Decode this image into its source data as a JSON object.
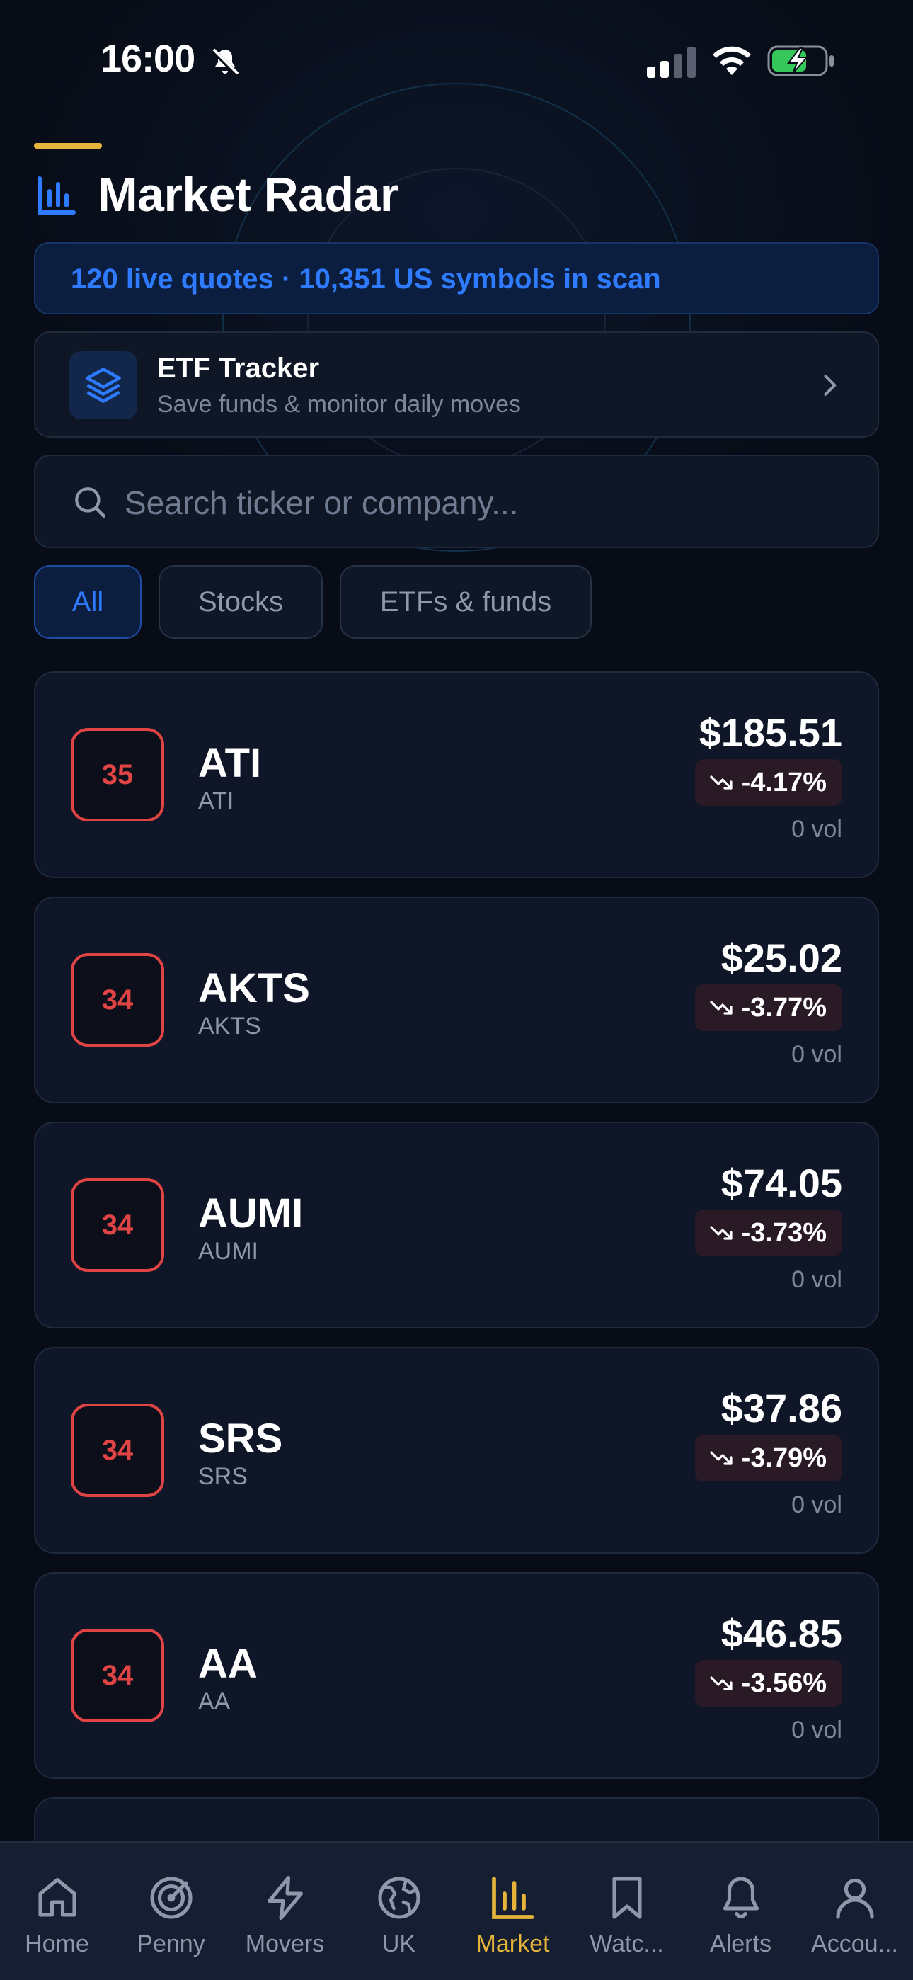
{
  "status_bar": {
    "time": "16:00"
  },
  "header": {
    "title": "Market Radar"
  },
  "live_banner": {
    "text": "120 live quotes · 10,351 US symbols in scan"
  },
  "etf_card": {
    "title": "ETF Tracker",
    "subtitle": "Save funds & monitor daily moves"
  },
  "search": {
    "placeholder": "Search ticker or company..."
  },
  "filters": {
    "all": "All",
    "stocks": "Stocks",
    "etfs": "ETFs & funds",
    "selected": "All"
  },
  "stocks": [
    {
      "score": "35",
      "ticker": "ATI",
      "name": "ATI",
      "price": "$185.51",
      "change": "-4.17%",
      "volume": "0 vol"
    },
    {
      "score": "34",
      "ticker": "AKTS",
      "name": "AKTS",
      "price": "$25.02",
      "change": "-3.77%",
      "volume": "0 vol"
    },
    {
      "score": "34",
      "ticker": "AUMI",
      "name": "AUMI",
      "price": "$74.05",
      "change": "-3.73%",
      "volume": "0 vol"
    },
    {
      "score": "34",
      "ticker": "SRS",
      "name": "SRS",
      "price": "$37.86",
      "change": "-3.79%",
      "volume": "0 vol"
    },
    {
      "score": "34",
      "ticker": "AA",
      "name": "AA",
      "price": "$46.85",
      "change": "-3.56%",
      "volume": "0 vol"
    }
  ],
  "tabs": [
    {
      "label": "Home",
      "icon": "home-icon"
    },
    {
      "label": "Penny",
      "icon": "radar-icon"
    },
    {
      "label": "Movers",
      "icon": "bolt-icon"
    },
    {
      "label": "UK",
      "icon": "globe-icon"
    },
    {
      "label": "Market",
      "icon": "bar-chart-icon"
    },
    {
      "label": "Watc...",
      "icon": "bookmark-icon"
    },
    {
      "label": "Alerts",
      "icon": "bell-icon"
    },
    {
      "label": "Accou...",
      "icon": "user-icon"
    }
  ],
  "active_tab": "Market",
  "colors": {
    "background": "#070c17",
    "accent_gold": "#e6b43a",
    "accent_blue": "#2e7bff",
    "negative_red": "#e04444",
    "card": "#0e1628",
    "muted_text": "#8d98ab"
  }
}
